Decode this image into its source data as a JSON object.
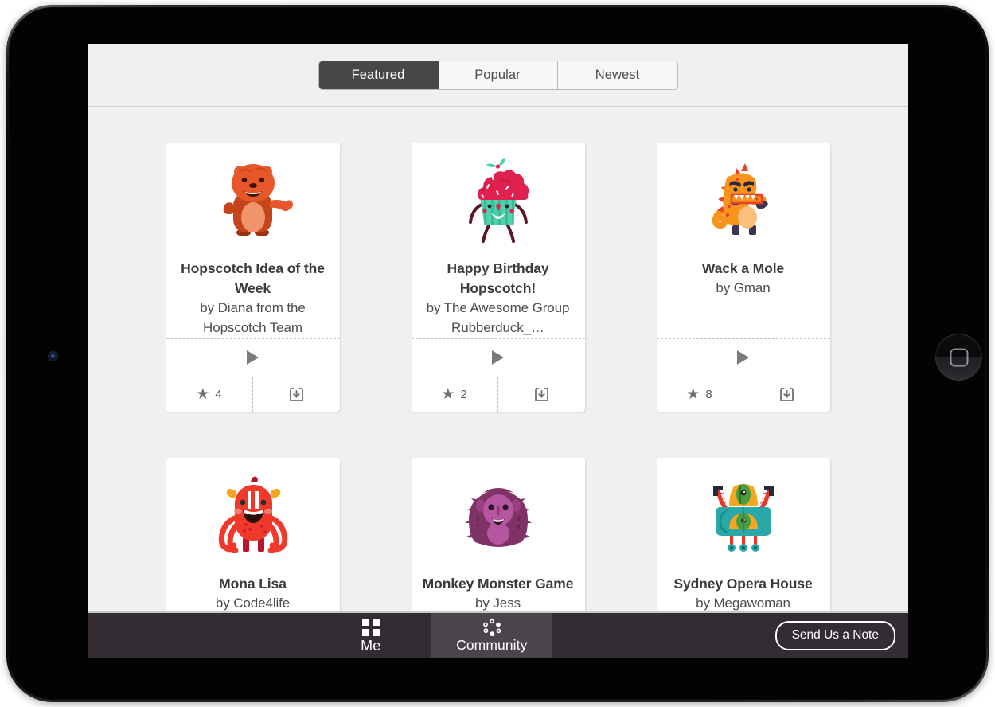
{
  "app": {
    "name": "Hopscotch",
    "device": "tablet"
  },
  "header": {
    "tabs": [
      {
        "label": "Featured",
        "active": true
      },
      {
        "label": "Popular",
        "active": false
      },
      {
        "label": "Newest",
        "active": false
      }
    ]
  },
  "projects": [
    {
      "title": "Hopscotch Idea of the Week",
      "author": "by Diana from the Hopscotch Team",
      "author_wraps": true,
      "stars": "4",
      "art": "bear",
      "has_actions": true
    },
    {
      "title": "Happy Birthday Hopscotch!",
      "author": "by The Awesome Group Rubberduck_…",
      "author_wraps": true,
      "stars": "2",
      "art": "cupcake",
      "has_actions": true
    },
    {
      "title": "Wack a Mole",
      "author": "by Gman",
      "author_wraps": false,
      "stars": "8",
      "art": "dino",
      "has_actions": true
    },
    {
      "title": "Mona Lisa",
      "author": "by Code4life",
      "author_wraps": false,
      "stars": "",
      "art": "octomonster",
      "has_actions": false
    },
    {
      "title": "Monkey Monster Game",
      "author": "by Jess",
      "author_wraps": true,
      "stars": "",
      "art": "ape",
      "has_actions": false
    },
    {
      "title": "Sydney Opera House",
      "author": "by Megawoman",
      "author_wraps": false,
      "stars": "",
      "art": "robot",
      "has_actions": false
    }
  ],
  "icons": {
    "play": "play-icon",
    "star": "★",
    "download": "download-icon",
    "me_tab": "grid-icon",
    "community_tab": "community-dots-icon"
  },
  "navbar": {
    "tabs": [
      {
        "label": "Me",
        "icon": "grid-icon",
        "active": false
      },
      {
        "label": "Community",
        "icon": "community-dots-icon",
        "active": true
      }
    ],
    "send_note_label": "Send Us a Note"
  },
  "colors": {
    "screen_bg": "#f0f0f0",
    "card_bg": "#ffffff",
    "nav_bg": "#332c33",
    "nav_active": "#4a454a",
    "segment_active": "#474747",
    "title_text": "#3a3a3d",
    "body_text": "#4d4d4d"
  }
}
